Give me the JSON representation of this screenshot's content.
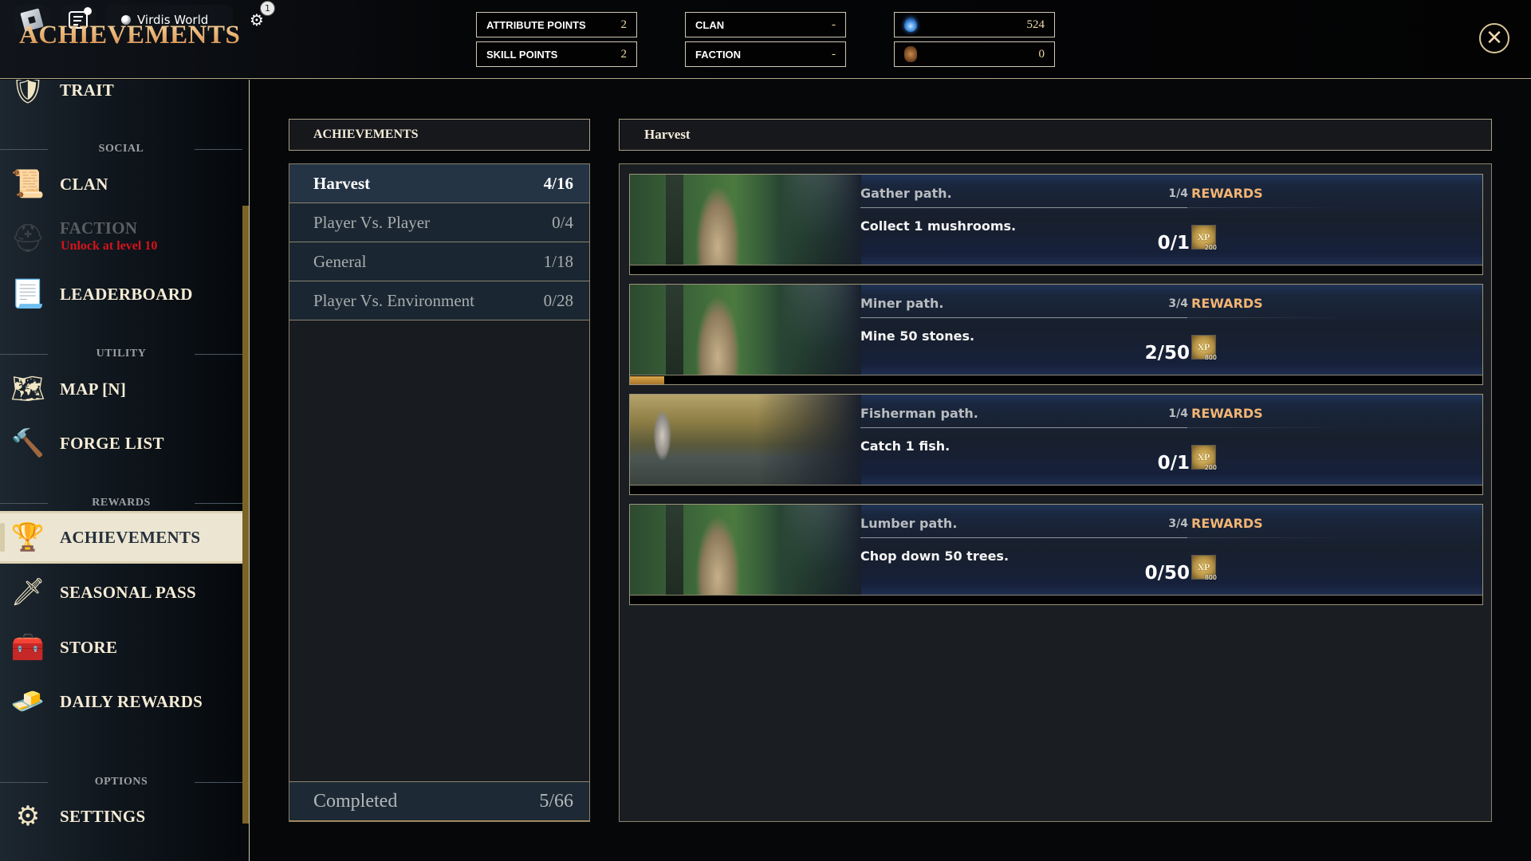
{
  "topbar": {
    "world_name": "Virdis World",
    "notification_count": "1",
    "page_title": "ACHIEVEMENTS",
    "stats": [
      {
        "label": "ATTRIBUTE POINTS",
        "value": "2"
      },
      {
        "label": "SKILL POINTS",
        "value": "2"
      },
      {
        "label": "CLAN",
        "value": "-"
      },
      {
        "label": "FACTION",
        "value": "-"
      }
    ],
    "currencies": [
      {
        "icon": "soul-orb-icon",
        "value": "524"
      },
      {
        "icon": "rune-token-icon",
        "value": "0"
      }
    ],
    "close_glyph": "✕"
  },
  "sidebar": {
    "sections": {
      "social": "SOCIAL",
      "utility": "UTILITY",
      "rewards": "REWARDS",
      "options": "OPTIONS"
    },
    "items": [
      {
        "label": "TRAIT",
        "icon": "armor-icon"
      },
      {
        "label": "CLAN",
        "icon": "scroll-icon"
      },
      {
        "label": "FACTION",
        "icon": "helmet-icon",
        "locked": true,
        "lock_note": "Unlock at level 10"
      },
      {
        "label": "LEADERBOARD",
        "icon": "parchment-icon"
      },
      {
        "label": "MAP [N]",
        "icon": "map-icon"
      },
      {
        "label": "FORGE LIST",
        "icon": "hammer-icon"
      },
      {
        "label": "ACHIEVEMENTS",
        "icon": "goblet-icon",
        "active": true
      },
      {
        "label": "SEASONAL PASS",
        "icon": "sword-icon"
      },
      {
        "label": "STORE",
        "icon": "chest-icon"
      },
      {
        "label": "DAILY REWARDS",
        "icon": "gold-bars-icon"
      },
      {
        "label": "SETTINGS",
        "icon": "cog-icon"
      }
    ]
  },
  "categories": {
    "header": "ACHIEVEMENTS",
    "items": [
      {
        "name": "Harvest",
        "progress": "4/16",
        "active": true
      },
      {
        "name": "Player Vs. Player",
        "progress": "0/4"
      },
      {
        "name": "General",
        "progress": "1/18"
      },
      {
        "name": "Player Vs. Environment",
        "progress": "0/28"
      }
    ],
    "completed_label": "Completed",
    "completed_value": "5/66"
  },
  "detail": {
    "header": "Harvest",
    "rewards_label": "REWARDS",
    "cards": [
      {
        "title": "Gather path.",
        "step": "1/4",
        "description": "Collect 1 mushrooms.",
        "progress": "0/1",
        "progress_fraction": 0.0,
        "art": "forest",
        "reward": {
          "glyph": "XP",
          "amount": "200"
        }
      },
      {
        "title": "Miner path.",
        "step": "3/4",
        "description": "Mine 50 stones.",
        "progress": "2/50",
        "progress_fraction": 0.04,
        "art": "forest",
        "reward": {
          "glyph": "XP",
          "amount": "800"
        }
      },
      {
        "title": "Fisherman path.",
        "step": "1/4",
        "description": "Catch 1 fish.",
        "progress": "0/1",
        "progress_fraction": 0.0,
        "art": "river",
        "reward": {
          "glyph": "XP",
          "amount": "200"
        }
      },
      {
        "title": "Lumber path.",
        "step": "3/4",
        "description": "Chop down 50 trees.",
        "progress": "0/50",
        "progress_fraction": 0.0,
        "art": "forest",
        "reward": {
          "glyph": "XP",
          "amount": "800"
        }
      }
    ]
  },
  "colors": {
    "accent_gold": "#f2b574",
    "title_gold": "#e9b97a",
    "locked_red": "#d5141c",
    "progress_fill": "#d9a54a",
    "scrollbar": "#7b6426"
  }
}
